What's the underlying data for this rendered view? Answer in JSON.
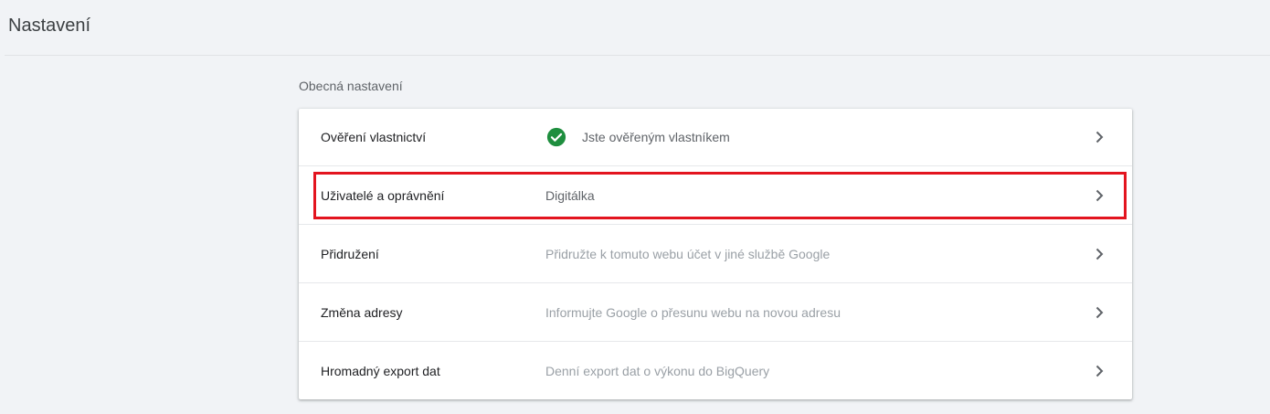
{
  "header": {
    "title": "Nastavení"
  },
  "section": {
    "title": "Obecná nastavení"
  },
  "rows": [
    {
      "label": "Ověření vlastnictví",
      "value": "Jste ověřeným vlastníkem",
      "icon": "check-circle-icon"
    },
    {
      "label": "Uživatelé a oprávnění",
      "value": "Digitálka",
      "highlighted": true
    },
    {
      "label": "Přidružení",
      "value": "Přidružte k tomuto webu účet v jiné službě Google"
    },
    {
      "label": "Změna adresy",
      "value": "Informujte Google o přesunu webu na novou adresu"
    },
    {
      "label": "Hromadný export dat",
      "value": "Denní export dat o výkonu do BigQuery"
    }
  ],
  "colors": {
    "background": "#f1f3f6",
    "card": "#ffffff",
    "check": "#1e8e3e",
    "highlight": "#e3141f"
  }
}
